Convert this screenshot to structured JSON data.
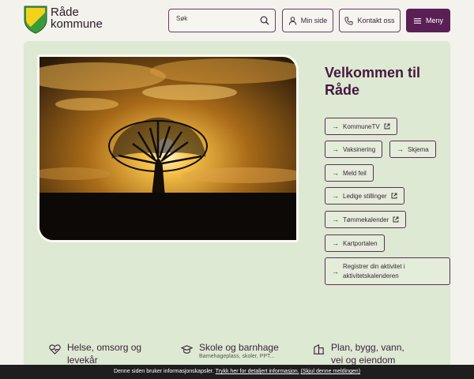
{
  "header": {
    "logo_line1": "Råde",
    "logo_line2": "kommune",
    "search_placeholder": "Søk",
    "min_side": "Min side",
    "kontakt": "Kontakt oss",
    "meny": "Meny"
  },
  "main": {
    "welcome": "Velkommen til Råde",
    "links": [
      {
        "label": "KommuneTV",
        "external": true
      },
      {
        "label": "Vaksinering",
        "external": false
      },
      {
        "label": "Skjema",
        "external": false
      },
      {
        "label": "Meld feil",
        "external": false
      },
      {
        "label": "Ledige stillinger",
        "external": true
      },
      {
        "label": "Tømmekalender",
        "external": true
      },
      {
        "label": "Kartportalen",
        "external": false
      },
      {
        "label": "Registrer din aktivitet i aktivitetskalenderen",
        "external": false
      }
    ]
  },
  "categories": [
    {
      "label": "Helse, omsorg og levekår",
      "icon": "heart-pulse-icon"
    },
    {
      "label": "Skole og barnhage",
      "icon": "graduation-cap-icon",
      "sub": "Barnehageplass, skoler, PPT..."
    },
    {
      "label": "Plan, bygg, vann, vei og eiendom",
      "icon": "building-icon"
    }
  ],
  "cookie": {
    "text": "Denne siden bruker informasjonskapsler.",
    "link1": "Trykk her for detaljert informasjon.",
    "link2": "(Skjul denne meldingen)"
  },
  "colors": {
    "brand": "#5a1f55",
    "panel": "#dde9d2",
    "page_bg": "#f3f2ec",
    "logo_green": "#3a9a3a",
    "logo_yellow": "#f2d21a"
  }
}
